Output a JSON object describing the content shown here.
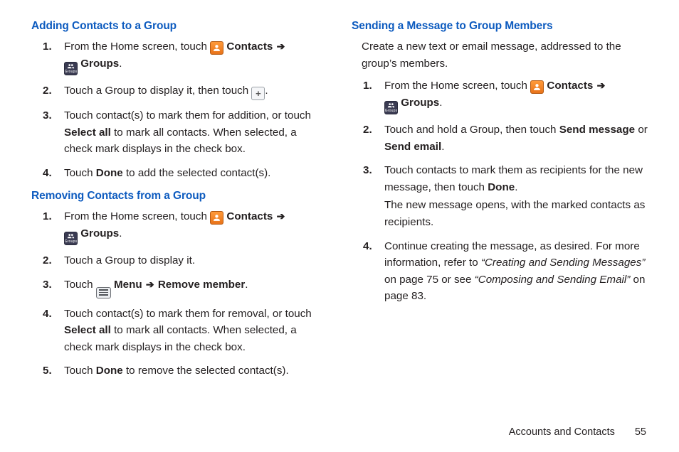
{
  "labels": {
    "contacts": "Contacts",
    "groups": "Groups",
    "menu": "Menu",
    "done": "Done",
    "select_all": "Select all",
    "remove_member": "Remove member",
    "send_message": "Send message",
    "send_email": "Send email"
  },
  "arrow": "➔",
  "left": {
    "section_a": {
      "heading": "Adding Contacts to a Group",
      "steps": [
        {
          "pre": "From the Home screen, touch ",
          "post1": " ",
          "post2": ".",
          "has_contacts_groups": true
        },
        {
          "pre": "Touch a Group to display it, then touch ",
          "has_plus": true,
          "after_plus": "."
        },
        {
          "pre": "Touch contact(s) to mark them for addition, or touch ",
          "bold": "Select all",
          "after": " to mark all contacts. When selected, a check mark displays in the check box."
        },
        {
          "pre": "Touch ",
          "bold": "Done",
          "after": " to add the selected contact(s)."
        }
      ]
    },
    "section_b": {
      "heading": "Removing Contacts from a Group",
      "steps": [
        {
          "pre": "From the Home screen, touch ",
          "has_contacts_groups": true,
          "post2": "."
        },
        {
          "pre": "Touch a Group to display it."
        },
        {
          "pre": "Touch ",
          "has_menu": true,
          "after_menu_bold": "Remove member",
          "after_menu_post": "."
        },
        {
          "pre": "Touch contact(s) to mark them for removal, or touch ",
          "bold": "Select all",
          "after": " to mark all contacts. When selected, a check mark displays in the check box."
        },
        {
          "pre": "Touch ",
          "bold": "Done",
          "after": " to remove the selected contact(s)."
        }
      ]
    }
  },
  "right": {
    "section_c": {
      "heading": "Sending a Message to Group Members",
      "intro": "Create a new text or email message, addressed to the group’s members.",
      "steps": {
        "s1_pre": "From the Home screen, touch ",
        "s2_pre": "Touch and hold a Group, then touch ",
        "s2_or": " or ",
        "s2_end": ".",
        "s3_a": "Touch contacts to mark them as recipients for the new message, then touch ",
        "s3_b": ".",
        "s3_cont": "The new message opens, with the marked contacts as recipients.",
        "s4_a": "Continue creating the message, as desired. For more information, refer to ",
        "s4_ref1": "“Creating and Sending Messages”",
        "s4_b": " on page 75 or see ",
        "s4_ref2": "“Composing and Sending Email”",
        "s4_c": " on page 83."
      }
    }
  },
  "footer": {
    "chapter": "Accounts and Contacts",
    "page": "55"
  },
  "icons": {
    "groups_label": "Groups",
    "plus_glyph": "+"
  }
}
